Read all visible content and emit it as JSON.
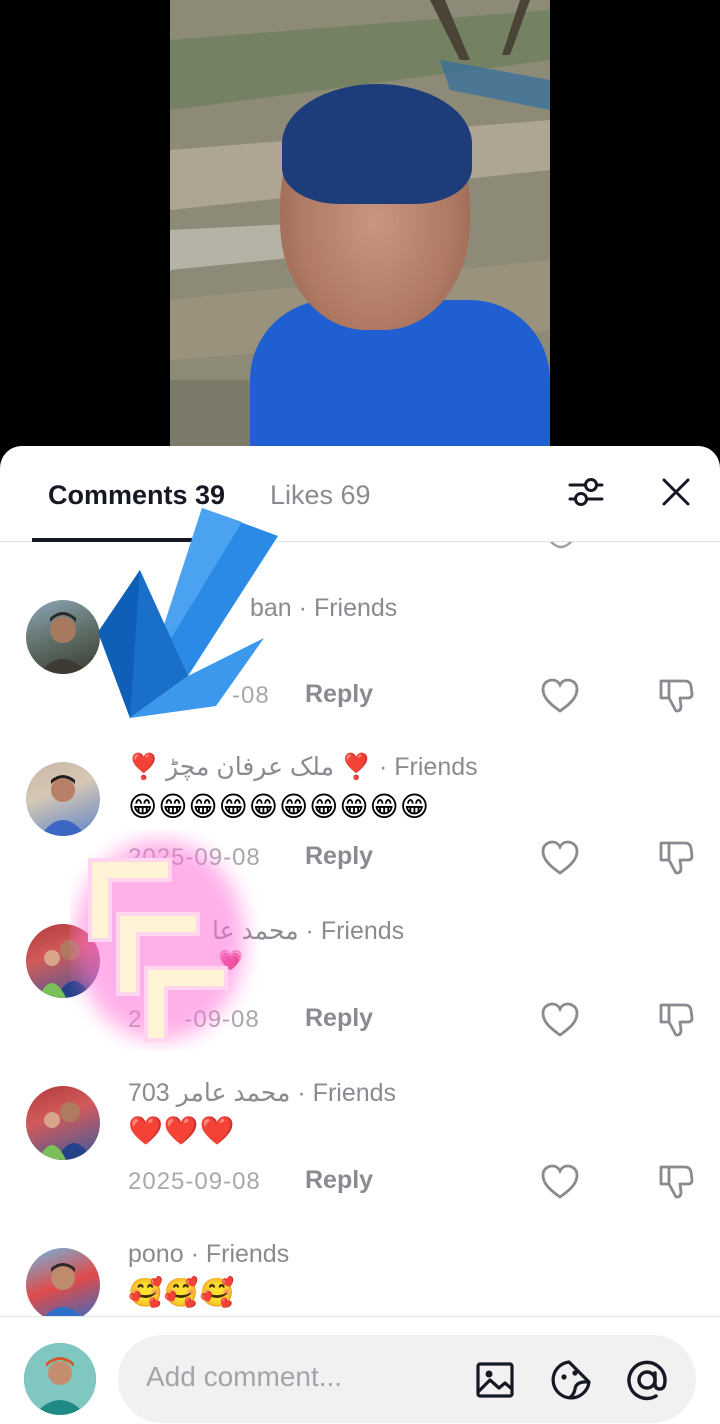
{
  "tabs": {
    "comments_label": "Comments 39",
    "likes_label": "Likes 69"
  },
  "icons": {
    "filter": "sliders-icon",
    "close": "close-icon",
    "like": "heart-outline-icon",
    "dislike": "thumbs-down-icon",
    "image": "image-icon",
    "sticker": "sticker-icon",
    "mention": "at-icon"
  },
  "comments": [
    {
      "name": "ban",
      "tag": "· Friends",
      "text": "",
      "date": "-08",
      "reply": "Reply"
    },
    {
      "name": "❣️ ملک عرفان مچڑ ❣️",
      "tag": "· Friends",
      "text": "😁😁😁😁😁😁😁😁😁😁",
      "date": "2025-09-08",
      "reply": "Reply"
    },
    {
      "name": "محمد عا",
      "tag": "· Friends",
      "text": "💗",
      "date": "-09-08",
      "date_prefix": "2",
      "reply": "Reply"
    },
    {
      "name": "703 محمد عامر",
      "tag": "· Friends",
      "text": "❤️❤️❤️",
      "date": "2025-09-08",
      "reply": "Reply"
    },
    {
      "name": "pono",
      "tag": "· Friends",
      "text": "🥰🥰🥰",
      "date": "",
      "reply": ""
    }
  ],
  "composer": {
    "placeholder": "Add comment..."
  },
  "colors": {
    "accent_underline": "#161823",
    "muted": "#8a8b91",
    "input_bg": "#f1f1f2",
    "arrow_blue": "#1e7fd8",
    "glow_pink": "#ff6fd8"
  }
}
